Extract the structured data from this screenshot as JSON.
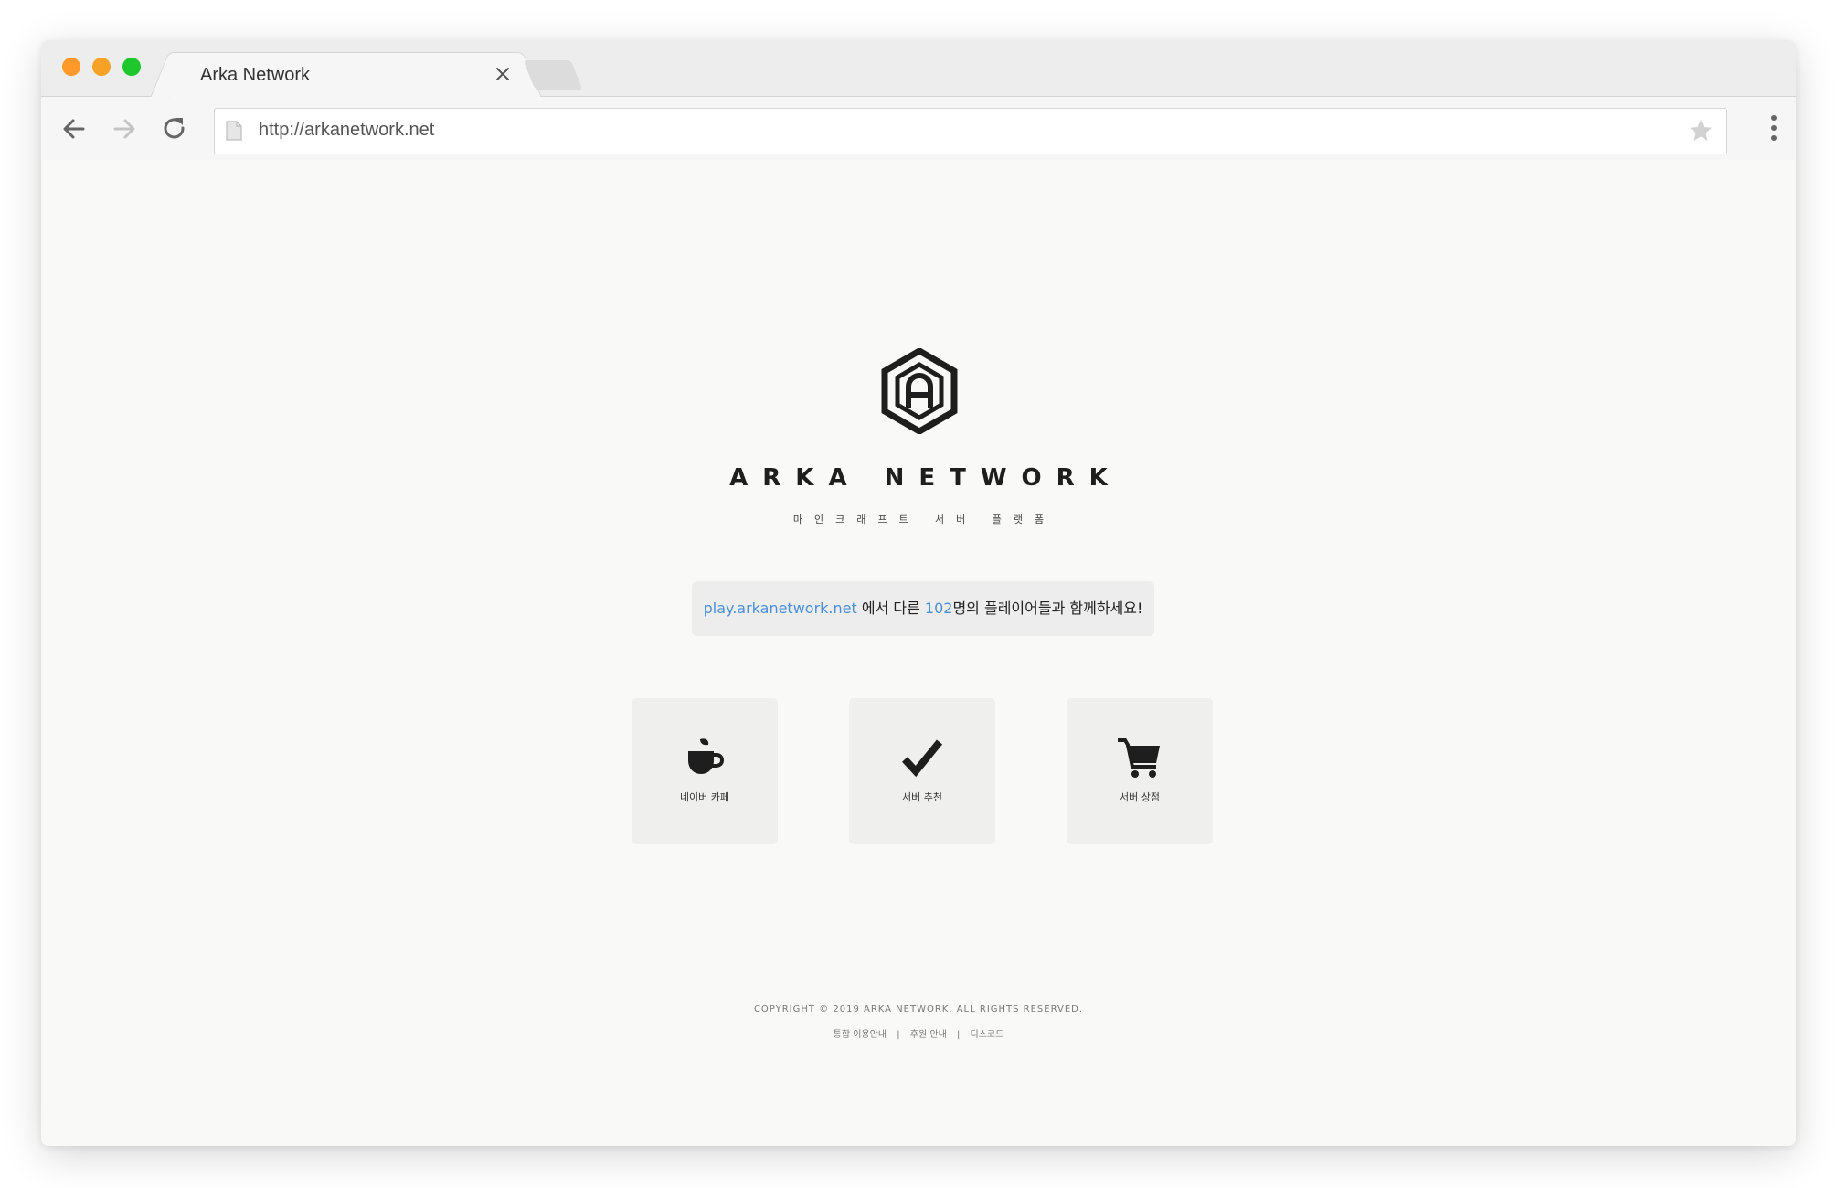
{
  "browser": {
    "tab_title": "Arka Network",
    "url": "http://arkanetwork.net"
  },
  "page": {
    "brand": "ARKA NETWORK",
    "tagline": "마인크래프트 서버 플랫폼",
    "notice": {
      "server_address": "play.arkanetwork.net",
      "middle_text": " 에서 다른 ",
      "player_count": "102",
      "end_text": "명의 플레이어들과 함께하세요!"
    },
    "cards": [
      {
        "label": "네이버 카페",
        "icon": "coffee-cup-icon"
      },
      {
        "label": "서버 추천",
        "icon": "checkmark-icon"
      },
      {
        "label": "서버 상점",
        "icon": "shopping-cart-icon"
      }
    ],
    "footer": {
      "copyright": "COPYRIGHT © 2019 ARKA NETWORK. ALL RIGHTS RESERVED.",
      "links": [
        "통합 이용안내",
        "후원 안내",
        "디스코드"
      ],
      "separator": "|"
    }
  },
  "colors": {
    "traffic_close": "#ff9c2a",
    "traffic_min": "#f5a623",
    "traffic_max": "#1dca2c",
    "accent": "#4a90d9",
    "page_bg": "#f9f9f7",
    "card_bg": "#efefed"
  }
}
